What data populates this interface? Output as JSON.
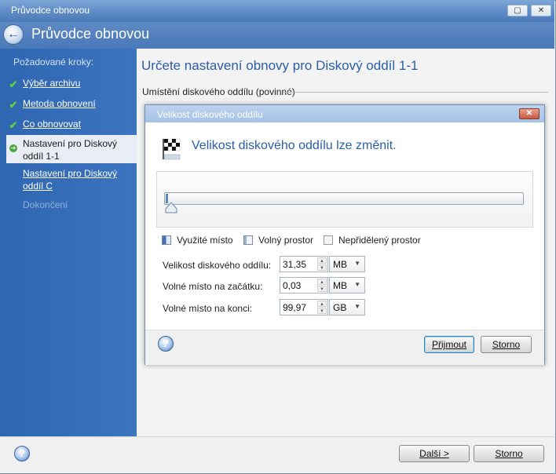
{
  "window": {
    "title": "Průvodce obnovou",
    "restore_glyph": "▢",
    "close_glyph": "✕"
  },
  "header": {
    "title": "Průvodce obnovou",
    "back_icon": "back-arrow-icon"
  },
  "sidebar": {
    "heading": "Požadované kroky:",
    "steps": [
      {
        "label": "Výběr archivu",
        "state": "done"
      },
      {
        "label": "Metoda obnovení",
        "state": "done"
      },
      {
        "label": "Co obnovovat",
        "state": "done"
      },
      {
        "label_line1": "Nastavení pro Diskový",
        "label_line2": "oddíl 1-1",
        "state": "current"
      },
      {
        "label_line1": "Nastavení pro Diskový",
        "label_line2": "oddíl C",
        "state": "pending"
      },
      {
        "label": "Dokončení",
        "state": "disabled"
      }
    ],
    "check_glyph": "✔",
    "current_glyph": "➔"
  },
  "main": {
    "title": "Určete nastavení obnovy pro Diskový oddíl 1-1",
    "section_label": "Umístění diskového oddílu (povinné)"
  },
  "dialog": {
    "title": "Velikost diskového oddílu",
    "heading": "Velikost diskového oddílu lze změnit.",
    "slider_position_fraction": 0.003,
    "legend": {
      "used": "Využité místo",
      "free": "Volný prostor",
      "unallocated": "Nepřidělený prostor"
    },
    "fields": [
      {
        "label": "Velikost diskového oddílu:",
        "value": "31,35",
        "unit": "MB"
      },
      {
        "label": "Volné místo na začátku:",
        "value": "0,03",
        "unit": "MB"
      },
      {
        "label": "Volné místo na konci:",
        "value": "99,97",
        "unit": "GB"
      }
    ],
    "accept": "Přijmout",
    "cancel": "Storno",
    "close_glyph": "✕"
  },
  "footer": {
    "next": "Další >",
    "cancel": "Storno"
  },
  "help_glyph": "?",
  "colors": {
    "accent": "#2a5ea8",
    "sidebar": "#3369b5",
    "check": "#5fd23b"
  }
}
